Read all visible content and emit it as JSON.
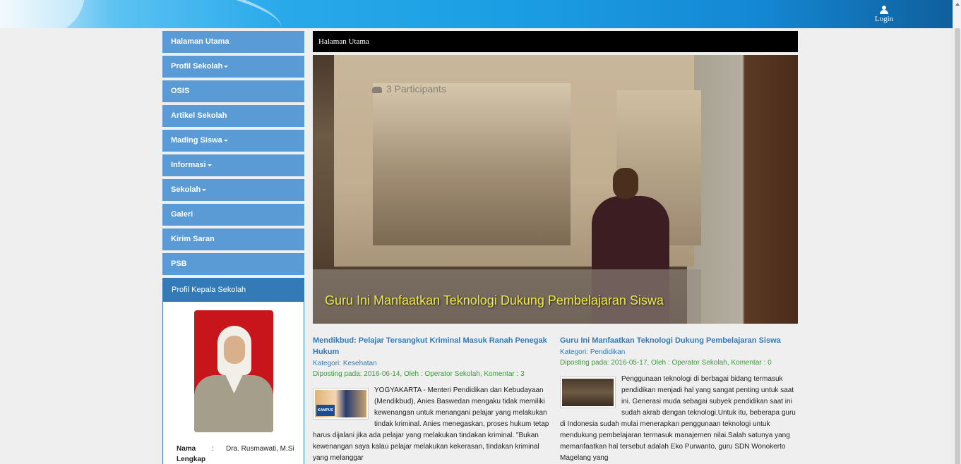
{
  "header": {
    "login_label": "Login"
  },
  "sidebar": {
    "items": [
      {
        "label": "Halaman Utama",
        "dropdown": false
      },
      {
        "label": "Profil Sekolah",
        "dropdown": true
      },
      {
        "label": "OSIS",
        "dropdown": false
      },
      {
        "label": "Artikel Sekolah",
        "dropdown": false
      },
      {
        "label": "Mading Siswa",
        "dropdown": true
      },
      {
        "label": "Informasi",
        "dropdown": true
      },
      {
        "label": "Sekolah",
        "dropdown": true
      },
      {
        "label": "Galeri",
        "dropdown": false
      },
      {
        "label": "Kirim Saran",
        "dropdown": false
      },
      {
        "label": "PSB",
        "dropdown": false
      }
    ],
    "profile": {
      "heading": "Profil Kepala Sekolah",
      "name_key": "Nama Lengkap",
      "separator": ":",
      "name_value": "Dra. Rusmawati, M.Si"
    }
  },
  "main": {
    "page_title": "Halaman Utama",
    "slider": {
      "caption": "Guru Ini Manfaatkan Teknologi Dukung Pembelajaran Siswa",
      "screen_text": "3 Participants"
    },
    "articles": [
      {
        "title": "Mendikbud: Pelajar Tersangkut Kriminal Masuk Ranah Penegak Hukum",
        "category_prefix": "Kategori: ",
        "category": "Kesehatan",
        "meta": "Diposting pada: 2016-06-14, Oleh : Operator Sekolah, Komentar : 3",
        "thumb_text": "KAMPUS",
        "body": "YOGYAKARTA - Menteri Pendidikan dan Kebudayaan (Mendikbud), Anies Baswedan mengaku tidak memiliki kewenangan untuk menangani pelajar yang melakukan tindak kriminal. Anies menegaskan, proses hukum tetap harus dijalani jika ada pelajar yang melakukan tindakan kriminal. \"Bukan kewenangan saya kalau pelajar melakukan kekerasan, tindakan kriminal yang melanggar"
      },
      {
        "title": "Guru Ini Manfaatkan Teknologi Dukung Pembelajaran Siswa",
        "category_prefix": "Kategori: ",
        "category": "Pendidikan",
        "meta": "Diposting pada: 2016-05-17, Oleh : Operator Sekolah, Komentar : 0",
        "body": "Penggunaan teknologi di berbagai bidang termasuk pendidikan menjadi hal yang sangat penting untuk saat ini. Generasi muda sebagai subyek pendidikan saat ini sudah akrab dengan teknologi.Untuk itu, beberapa guru di Indonesia sudah mulai menerapkan penggunaan teknologi untuk mendukung pembelajaran termasuk manajemen nilai.Salah satunya yang memanfaatkan hal tersebut adalah Eko Purwanto, guru SDN Wonokerto Magelang yang"
      }
    ]
  },
  "colors": {
    "nav_bg": "#5a9bd5",
    "panel_heading": "#337ab7",
    "link": "#337ab7",
    "meta_green": "#3c9a3c",
    "caption_text": "#f0e84a"
  }
}
